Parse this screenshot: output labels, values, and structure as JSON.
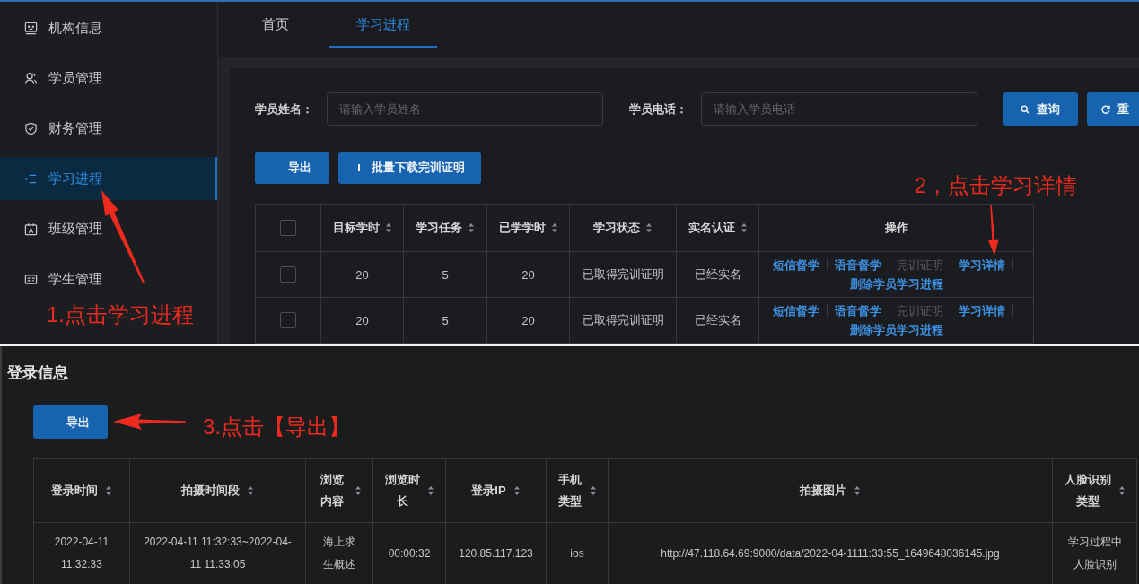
{
  "sidebar": {
    "items": [
      {
        "label": "机构信息",
        "selected": false
      },
      {
        "label": "学员管理",
        "selected": false
      },
      {
        "label": "财务管理",
        "selected": false
      },
      {
        "label": "学习进程",
        "selected": true
      },
      {
        "label": "班级管理",
        "selected": false
      },
      {
        "label": "学生管理",
        "selected": false
      }
    ]
  },
  "tabs": [
    {
      "label": "首页",
      "selected": false
    },
    {
      "label": "学习进程",
      "selected": true
    }
  ],
  "search": {
    "fields": [
      {
        "label": "学员姓名：",
        "placeholder": "请输入学员姓名"
      },
      {
        "label": "学员电话：",
        "placeholder": "请输入学员电话"
      }
    ],
    "buttons": [
      {
        "kind": "search",
        "label": "查询"
      },
      {
        "kind": "reset",
        "label": "重"
      }
    ]
  },
  "toolbar": {
    "buttons": [
      {
        "kind": "plain",
        "label": "导出"
      },
      {
        "kind": "download",
        "label": "批量下载完训证明"
      }
    ]
  },
  "progress_table": {
    "select_all": {
      "checked": false
    },
    "columns": [
      {
        "label": "目标学时",
        "sortable": true
      },
      {
        "label": "学习任务",
        "sortable": true
      },
      {
        "label": "已学学时",
        "sortable": true
      },
      {
        "label": "学习状态",
        "sortable": true
      },
      {
        "label": "实名认证",
        "sortable": true
      },
      {
        "label": "操作",
        "sortable": false
      }
    ],
    "rows": [
      {
        "checked": false,
        "cells": [
          "20",
          "5",
          "20",
          "已取得完训证明",
          "已经实名"
        ],
        "actions": [
          {
            "label": "短信督学",
            "disabled": false
          },
          {
            "label": "语音督学",
            "disabled": false
          },
          {
            "label": "完训证明",
            "disabled": true
          },
          {
            "label": "学习详情",
            "disabled": false
          },
          {
            "label": "删除学员学习进程",
            "disabled": false
          }
        ]
      },
      {
        "checked": false,
        "cells": [
          "20",
          "5",
          "20",
          "已取得完训证明",
          "已经实名"
        ],
        "actions": [
          {
            "label": "短信督学",
            "disabled": false
          },
          {
            "label": "语音督学",
            "disabled": false
          },
          {
            "label": "完训证明",
            "disabled": true
          },
          {
            "label": "学习详情",
            "disabled": false
          },
          {
            "label": "删除学员学习进程",
            "disabled": false
          }
        ]
      }
    ]
  },
  "login_info": {
    "title": "登录信息",
    "export_button": "导出",
    "table": {
      "columns": [
        {
          "label": "登录时间",
          "sortable": true
        },
        {
          "label": "拍摄时间段",
          "sortable": true
        },
        {
          "label": "浏览内容",
          "sortable": true
        },
        {
          "label": "浏览时长",
          "sortable": true
        },
        {
          "label": "登录IP",
          "sortable": true
        },
        {
          "label": "手机类型",
          "sortable": true
        },
        {
          "label": "拍摄图片",
          "sortable": true
        },
        {
          "label": "人脸识别类型",
          "sortable": true
        }
      ],
      "rows": [
        {
          "cells": [
            "2022-04-11 11:32:33",
            "2022-04-11 11:32:33~2022-04-11 11:33:05",
            "海上求生概述",
            "00:00:32",
            "120.85.117.123",
            "ios",
            "http://47.118.64.69:9000/data/2022-04-1111:33:55_1649648036145.jpg",
            "学习过程中人脸识别"
          ]
        }
      ]
    }
  },
  "annotations": [
    {
      "text": "1.点击学习进程"
    },
    {
      "text": "2，点击学习详情"
    },
    {
      "text": "3.点击【导出】"
    }
  ]
}
